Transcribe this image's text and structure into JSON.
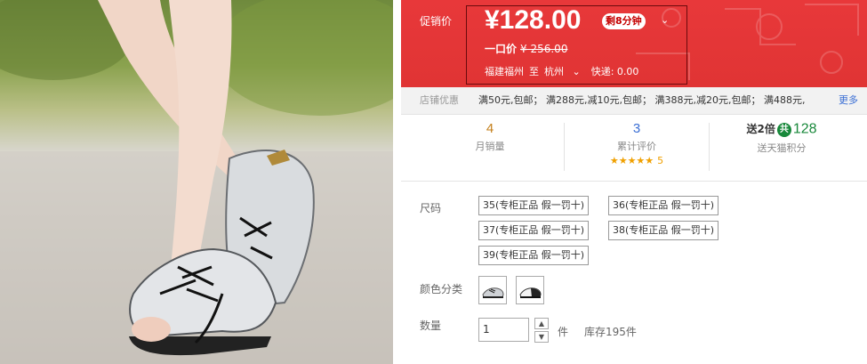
{
  "promo": {
    "label": "促销价",
    "price": "¥128.00",
    "timer": "剩8分钟",
    "original_label": "一口价",
    "original_price": "¥ 256.00",
    "ship_from": "福建福州",
    "ship_to_word": "至",
    "ship_to": "杭州",
    "shipping": "快递: 0.00"
  },
  "coupons": {
    "label": "店铺优惠",
    "list": "满50元,包邮； 满288元,减10元,包邮； 满388元,减20元,包邮； 满488元,",
    "more": "更多"
  },
  "stats": {
    "monthly_sales_value": "4",
    "monthly_sales_label": "月销量",
    "reviews_value": "3",
    "reviews_label": "累计评价",
    "rating_stars": "★★★★★",
    "rating_value": "5",
    "bonus_prefix": "送2倍",
    "bonus_badge": "共",
    "bonus_points": "128",
    "bonus_label": "送天猫积分"
  },
  "size": {
    "label": "尺码",
    "options": [
      "35(专柜正品 假一罚十)",
      "36(专柜正品 假一罚十)",
      "37(专柜正品 假一罚十)",
      "38(专柜正品 假一罚十)",
      "39(专柜正品 假一罚十)"
    ]
  },
  "color": {
    "label": "颜色分类",
    "swatches": [
      "silver-shoe-thumbnail",
      "black-white-shoe-thumbnail"
    ]
  },
  "quantity": {
    "label": "数量",
    "value": "1",
    "unit": "件",
    "stock": "库存195件"
  },
  "colors": {
    "promo_red": "#e4393c",
    "points_green": "#18883a",
    "link_blue": "#3a6ed4"
  }
}
